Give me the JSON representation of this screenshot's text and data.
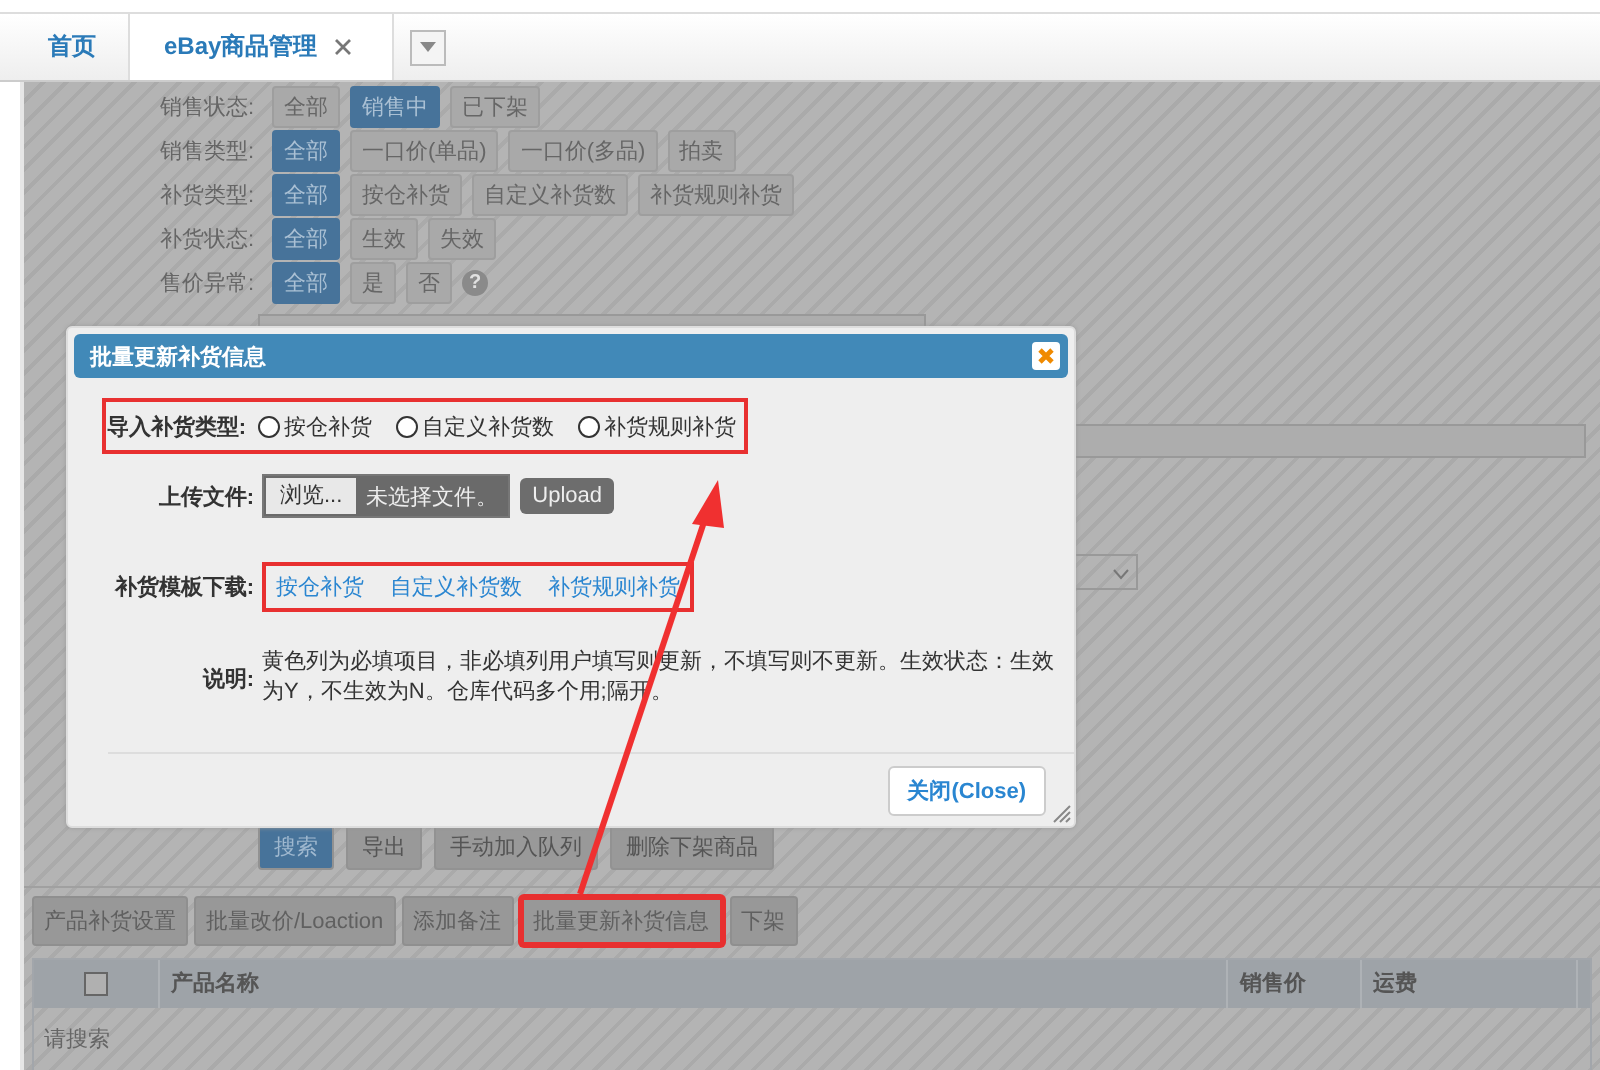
{
  "tabs": [
    {
      "label": "首页",
      "selected": false,
      "closable": false
    },
    {
      "label": "eBay商品管理",
      "selected": true,
      "closable": true
    }
  ],
  "filters": [
    {
      "label": "销售状态:",
      "options": [
        {
          "label": "全部",
          "selected": false
        },
        {
          "label": "销售中",
          "selected": true
        },
        {
          "label": "已下架",
          "selected": false
        }
      ]
    },
    {
      "label": "销售类型:",
      "options": [
        {
          "label": "全部",
          "selected": true
        },
        {
          "label": "一口价(单品)",
          "selected": false
        },
        {
          "label": "一口价(多品)",
          "selected": false
        },
        {
          "label": "拍卖",
          "selected": false
        }
      ]
    },
    {
      "label": "补货类型:",
      "options": [
        {
          "label": "全部",
          "selected": true
        },
        {
          "label": "按仓补货",
          "selected": false
        },
        {
          "label": "自定义补货数",
          "selected": false
        },
        {
          "label": "补货规则补货",
          "selected": false
        }
      ]
    },
    {
      "label": "补货状态:",
      "options": [
        {
          "label": "全部",
          "selected": true
        },
        {
          "label": "生效",
          "selected": false
        },
        {
          "label": "失效",
          "selected": false
        }
      ]
    },
    {
      "label": "售价异常:",
      "options": [
        {
          "label": "全部",
          "selected": true
        },
        {
          "label": "是",
          "selected": false
        },
        {
          "label": "否",
          "selected": false
        }
      ],
      "hint": "?"
    }
  ],
  "actions": [
    {
      "label": "搜索",
      "kind": "primary"
    },
    {
      "label": "导出",
      "kind": "default"
    },
    {
      "label": "手动加入队列",
      "kind": "default"
    },
    {
      "label": "删除下架商品",
      "kind": "default"
    }
  ],
  "toolbar": [
    {
      "label": "产品补货设置",
      "highlighted": false
    },
    {
      "label": "批量改价/Loaction",
      "highlighted": false
    },
    {
      "label": "添加备注",
      "highlighted": false
    },
    {
      "label": "批量更新补货信息",
      "highlighted": true
    },
    {
      "label": "下架",
      "highlighted": false
    }
  ],
  "table": {
    "select_all_checked": false,
    "columns": [
      "产品名称",
      "销售价",
      "运费"
    ],
    "empty_text": "请搜索"
  },
  "dialog": {
    "title": "批量更新补货信息",
    "import_type": {
      "label": "导入补货类型:",
      "highlighted": true,
      "options": [
        {
          "label": "按仓补货",
          "selected": false
        },
        {
          "label": "自定义补货数",
          "selected": false
        },
        {
          "label": "补货规则补货",
          "selected": false
        }
      ]
    },
    "upload": {
      "label": "上传文件:",
      "browse": "浏览...",
      "file_text": "未选择文件。",
      "button": "Upload"
    },
    "templates": {
      "label": "补货模板下载:",
      "highlighted": true,
      "links": [
        "按仓补货",
        "自定义补货数",
        "补货规则补货"
      ]
    },
    "note": {
      "label": "说明:",
      "text": "黄色列为必填项目，非必填列用户填写则更新，不填写则不更新。生效状态：生效为Y，不生效为N。仓库代码多个用;隔开。"
    },
    "close_button": "关闭(Close)"
  }
}
